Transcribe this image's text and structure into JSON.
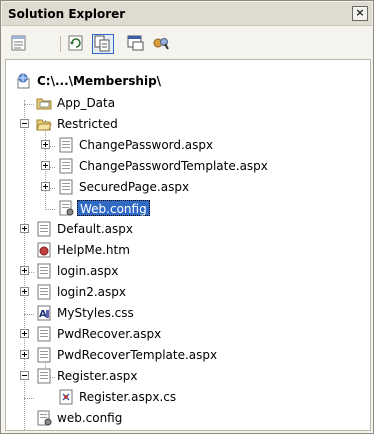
{
  "window": {
    "title": "Solution Explorer",
    "close_glyph": "×"
  },
  "toolbar": {
    "buttons": [
      {
        "icon": "properties-icon"
      },
      {
        "icon": "refresh-icon"
      },
      {
        "icon": "show-all-files-icon",
        "pressed": true
      },
      {
        "icon": "view-designer-icon"
      },
      {
        "icon": "copy-website-icon"
      }
    ]
  },
  "tree": {
    "root": "C:\\...\\Membership\\",
    "items": {
      "app_data": "App_Data",
      "restricted": "Restricted",
      "change_password": "ChangePassword.aspx",
      "change_password_template": "ChangePasswordTemplate.aspx",
      "secured_page": "SecuredPage.aspx",
      "restricted_web_config": "Web.config",
      "default": "Default.aspx",
      "helpme": "HelpMe.htm",
      "login": "login.aspx",
      "login2": "login2.aspx",
      "mystyles": "MyStyles.css",
      "pwdrecover": "PwdRecover.aspx",
      "pwdrecover_template": "PwdRecoverTemplate.aspx",
      "register": "Register.aspx",
      "register_cs": "Register.aspx.cs",
      "web_config": "web.config"
    },
    "selected": "restricted_web_config"
  },
  "colors": {
    "selection": "#316ac5",
    "folder": "#e8c860",
    "page": "#ffffff"
  }
}
